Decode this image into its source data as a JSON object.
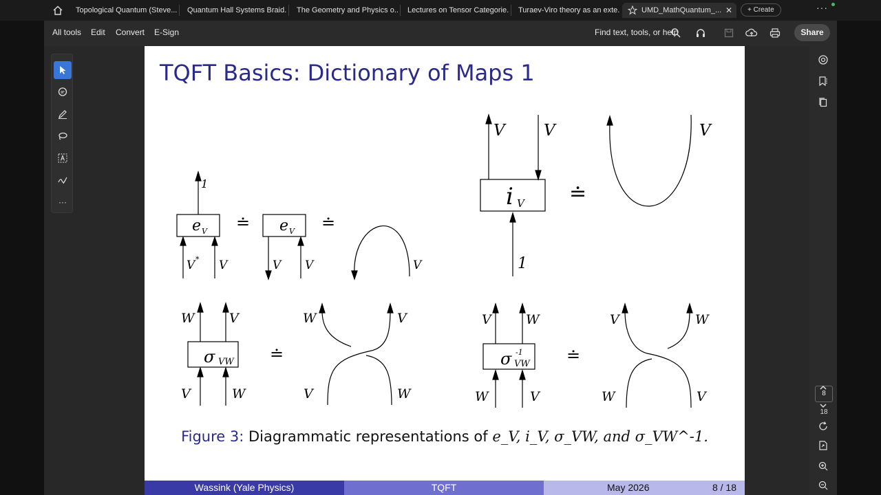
{
  "tabs": [
    {
      "label": "Topological Quantum (Steve...",
      "active": false
    },
    {
      "label": "Quantum Hall Systems Braid...",
      "active": false
    },
    {
      "label": "The Geometry and Physics o...",
      "active": false
    },
    {
      "label": "Lectures on Tensor Categorie...",
      "active": false
    },
    {
      "label": "Turaev-Viro theory as an exte...",
      "active": false
    },
    {
      "label": "UMD_MathQuantum_...",
      "active": true
    }
  ],
  "tab_close_glyph": "✕",
  "create_label": "+ Create",
  "more_glyph": "···",
  "menu": {
    "all_tools": "All tools",
    "edit": "Edit",
    "convert": "Convert",
    "esign": "E-Sign"
  },
  "find_label": "Find text, tools, or help",
  "share_label": "Share",
  "icons": {
    "home": "home-icon",
    "star": "star-icon",
    "search": "search-icon",
    "headphones": "read-aloud-icon",
    "save": "save-icon",
    "upload": "upload-icon",
    "print": "print-icon",
    "select": "cursor-icon",
    "comment": "comment-icon",
    "draw": "pen-icon",
    "lasso": "lasso-icon",
    "text_select": "text-box-icon",
    "sign": "sign-icon",
    "more": "more-icon",
    "ai": "ai-assistant-icon",
    "bookmark": "bookmark-icon",
    "pages": "pages-icon",
    "prev": "chevron-up-icon",
    "next": "chevron-down-icon",
    "refresh": "refresh-icon",
    "export": "export-icon",
    "zoom_in": "zoom-in-icon",
    "zoom_out": "zoom-out-icon"
  },
  "pager": {
    "current": "8",
    "total": "18"
  },
  "slide": {
    "title": "TQFT Basics: Dictionary of Maps 1",
    "caption_prefix": "Figure 3:",
    "caption_text": "Diagrammatic representations of",
    "caption_math": "e_V, i_V, σ_VW, and σ_VW^-1.",
    "footer_left": "Wassink  (Yale Physics)",
    "footer_mid": "TQFT",
    "footer_date": "May 2026",
    "footer_page": "8 / 18"
  },
  "diagram_labels": {
    "one": "1",
    "V": "V",
    "W": "W",
    "Vstar": "V",
    "star": "*",
    "e": "e",
    "i": "i",
    "sigma": "σ",
    "VW": "VW",
    "inv": "-1",
    "doteq": "≐"
  }
}
